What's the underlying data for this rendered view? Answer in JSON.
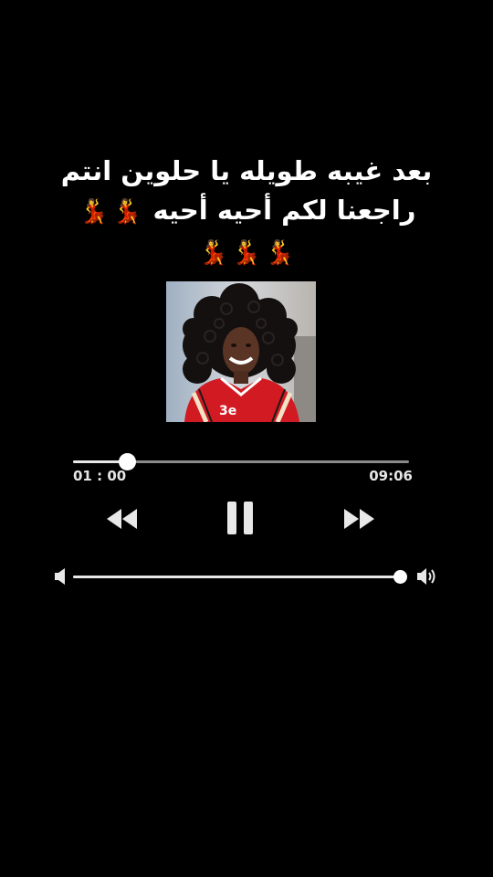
{
  "caption": {
    "line1": "بعد غيبه طويله يا حلوين انتم",
    "line2": "راجعنا  لكم أحيه أحيه",
    "emoji_glyph": "💃",
    "emoji_row1_count": 2,
    "emoji_row2_count": 3,
    "emoji_color": "#d8161f"
  },
  "player": {
    "elapsed": "01 : 00",
    "total": "09:06",
    "progress_fraction": 0.16,
    "volume_fraction": 0.99,
    "controls": {
      "rewind_icon": "rewind-icon",
      "pause_icon": "pause-icon",
      "forward_icon": "fast-forward-icon",
      "volume_low_icon": "volume-low-icon",
      "volume_high_icon": "volume-high-icon"
    }
  },
  "colors": {
    "background": "#000000",
    "text": "#ffffff",
    "track": "#8a8a8a",
    "track_fill": "#e8e8e8"
  }
}
